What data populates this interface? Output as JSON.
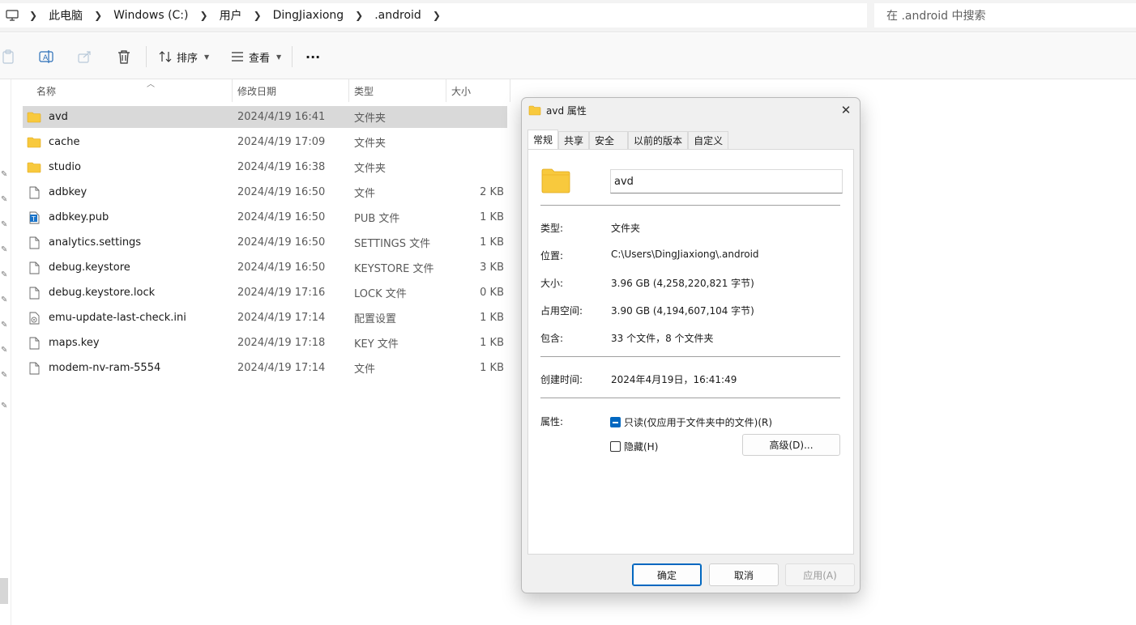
{
  "address": {
    "crumbs": [
      "此电脑",
      "Windows (C:)",
      "用户",
      "DingJiaxiong",
      ".android"
    ],
    "search_placeholder": "在 .android 中搜索"
  },
  "toolbar": {
    "sort_label": "排序",
    "view_label": "查看",
    "more_label": "···"
  },
  "columns": {
    "name": "名称",
    "date": "修改日期",
    "type": "类型",
    "size": "大小"
  },
  "files": [
    {
      "name": "avd",
      "date": "2024/4/19 16:41",
      "type": "文件夹",
      "size": "",
      "icon": "folder-icon",
      "selected": true
    },
    {
      "name": "cache",
      "date": "2024/4/19 17:09",
      "type": "文件夹",
      "size": "",
      "icon": "folder-icon"
    },
    {
      "name": "studio",
      "date": "2024/4/19 16:38",
      "type": "文件夹",
      "size": "",
      "icon": "folder-icon"
    },
    {
      "name": "adbkey",
      "date": "2024/4/19 16:50",
      "type": "文件",
      "size": "2 KB",
      "icon": "file-icon"
    },
    {
      "name": "adbkey.pub",
      "date": "2024/4/19 16:50",
      "type": "PUB 文件",
      "size": "1 KB",
      "icon": "text-file-icon"
    },
    {
      "name": "analytics.settings",
      "date": "2024/4/19 16:50",
      "type": "SETTINGS 文件",
      "size": "1 KB",
      "icon": "file-icon"
    },
    {
      "name": "debug.keystore",
      "date": "2024/4/19 16:50",
      "type": "KEYSTORE 文件",
      "size": "3 KB",
      "icon": "file-icon"
    },
    {
      "name": "debug.keystore.lock",
      "date": "2024/4/19 17:16",
      "type": "LOCK 文件",
      "size": "0 KB",
      "icon": "file-icon"
    },
    {
      "name": "emu-update-last-check.ini",
      "date": "2024/4/19 17:14",
      "type": "配置设置",
      "size": "1 KB",
      "icon": "ini-file-icon"
    },
    {
      "name": "maps.key",
      "date": "2024/4/19 17:18",
      "type": "KEY 文件",
      "size": "1 KB",
      "icon": "file-icon"
    },
    {
      "name": "modem-nv-ram-5554",
      "date": "2024/4/19 17:14",
      "type": "文件",
      "size": "1 KB",
      "icon": "file-icon"
    }
  ],
  "dialog": {
    "title": "avd 属性",
    "tabs": [
      "常规",
      "共享",
      "安全",
      "以前的版本",
      "自定义"
    ],
    "active_tab": 0,
    "folder_name": "avd",
    "props": {
      "type_label": "类型:",
      "type_value": "文件夹",
      "location_label": "位置:",
      "location_value": "C:\\Users\\DingJiaxiong\\.android",
      "size_label": "大小:",
      "size_value": "3.96 GB (4,258,220,821 字节)",
      "disk_label": "占用空间:",
      "disk_value": "3.90 GB (4,194,607,104 字节)",
      "contains_label": "包含:",
      "contains_value": "33 个文件，8 个文件夹",
      "created_label": "创建时间:",
      "created_value": "2024年4月19日，16:41:49",
      "attrs_label": "属性:"
    },
    "readonly_label": "只读(仅应用于文件夹中的文件)(R)",
    "hidden_label": "隐藏(H)",
    "advanced_label": "高级(D)...",
    "ok_label": "确定",
    "cancel_label": "取消",
    "apply_label": "应用(A)"
  }
}
